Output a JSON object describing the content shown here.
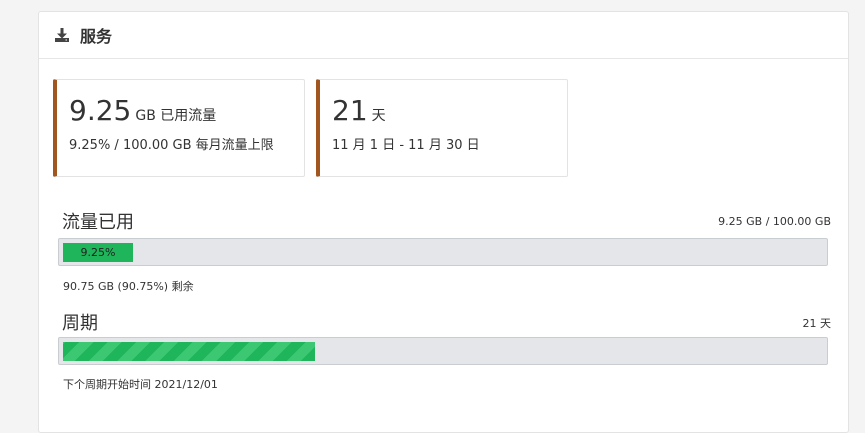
{
  "panel": {
    "title": "服务",
    "icon": "download-icon"
  },
  "cards": {
    "traffic": {
      "value": "9.25",
      "unit": "GB 已用流量",
      "sub": "9.25% / 100.00 GB 每月流量上限"
    },
    "days": {
      "value": "21",
      "unit": "天",
      "sub": "11 月 1 日 - 11 月 30 日"
    },
    "accent_color": "#a0561e"
  },
  "traffic_section": {
    "title": "流量已用",
    "summary": "9.25 GB / 100.00 GB",
    "progress_label": "9.25%",
    "progress_fraction": 0.0925,
    "remaining": "90.75 GB (90.75%) 剩余",
    "bar_color": "#1fb55a"
  },
  "cycle_section": {
    "title": "周期",
    "summary": "21 天",
    "progress_fraction": 0.3311,
    "next_cycle": "下个周期开始时间 2021/12/01",
    "bar_color": "#1fb55a"
  }
}
